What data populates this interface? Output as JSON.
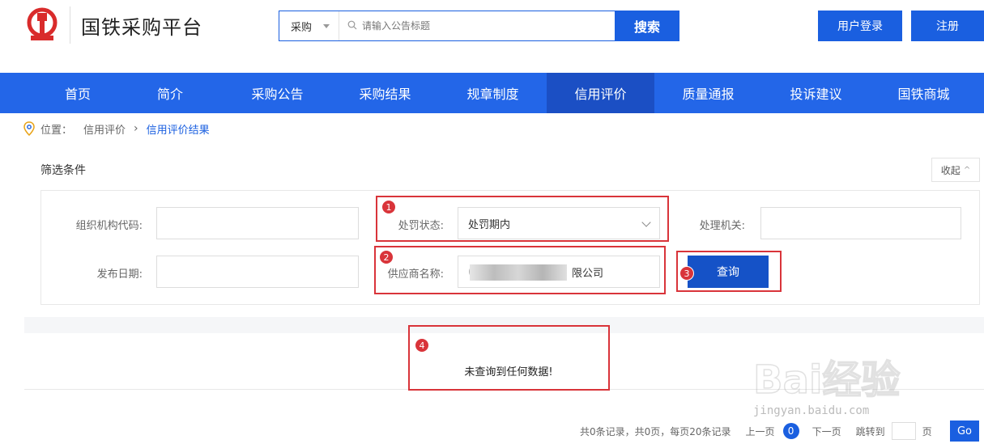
{
  "header": {
    "site_title": "国铁采购平台",
    "search_category": "采购",
    "search_placeholder": "请输入公告标题",
    "search_button": "搜索",
    "login_button": "用户登录",
    "register_button": "注册"
  },
  "nav": {
    "items": [
      "首页",
      "简介",
      "采购公告",
      "采购结果",
      "规章制度",
      "信用评价",
      "质量通报",
      "投诉建议",
      "国铁商城"
    ],
    "active_index": 5
  },
  "breadcrumb": {
    "prefix": "位置：",
    "level1": "信用评价",
    "level2": "信用评价结果"
  },
  "filter": {
    "title": "筛选条件",
    "collapse_label": "收起",
    "org_code_label": "组织机构代码:",
    "org_code_value": "",
    "penalty_status_label": "处罚状态:",
    "penalty_status_value": "处罚期内",
    "handling_org_label": "处理机关:",
    "handling_org_value": "",
    "publish_date_label": "发布日期:",
    "publish_date_value": "",
    "supplier_name_label": "供应商名称:",
    "supplier_name_prefix": "(",
    "supplier_name_suffix": "限公司",
    "query_button": "查询"
  },
  "result": {
    "empty_message": "未查询到任何数据!"
  },
  "pagination": {
    "summary": "共0条记录，共0页，每页20条记录",
    "prev": "上一页",
    "current_page": "0",
    "next": "下一页",
    "jump_label": "跳转到",
    "page_unit": "页",
    "go_button": "Go"
  },
  "annotations": [
    "1",
    "2",
    "3",
    "4"
  ],
  "watermark": {
    "text": "Bai经验",
    "url_text": "jingyan.baidu.com"
  },
  "colors": {
    "primary": "#1a5fe0",
    "nav_bg": "#2366e8",
    "nav_active": "#1b4fc4",
    "annotation": "#d9343a",
    "logo_red": "#d92b2b"
  }
}
